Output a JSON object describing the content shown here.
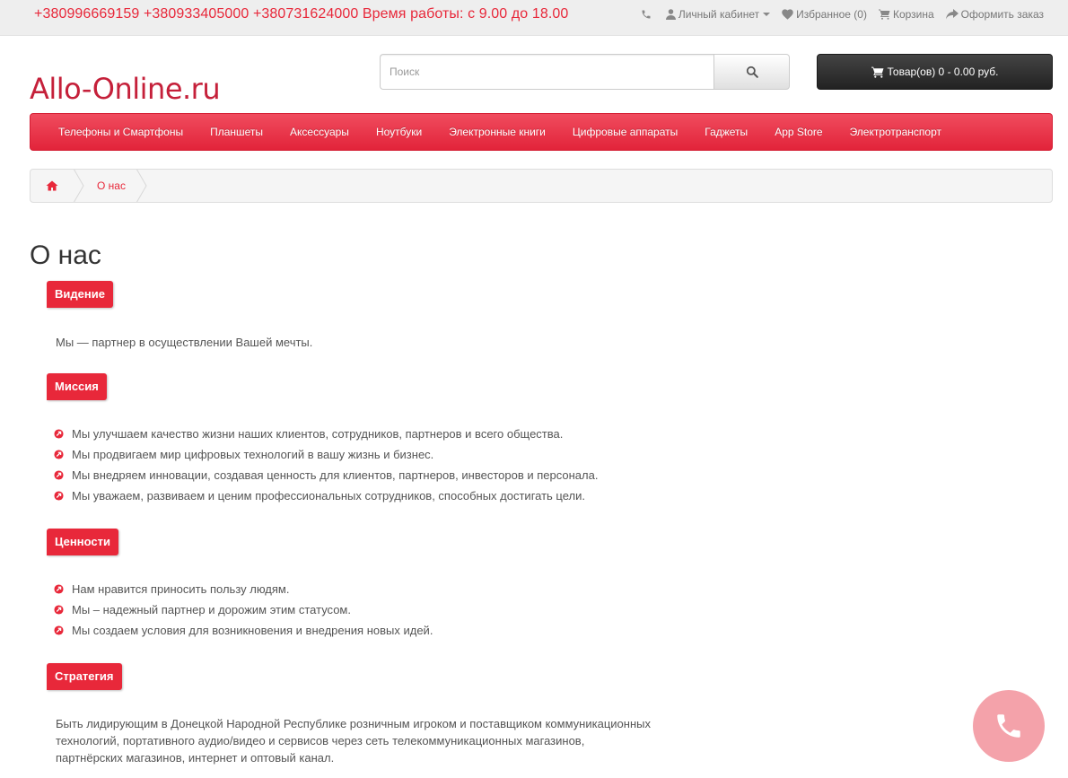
{
  "topbar": {
    "phones": "+380996669159 +380933405000 +380731624000 Время работы: с 9.00 до 18.00",
    "account_label": "Личный кабинет",
    "wishlist_label": "Избранное (0)",
    "cart_label": "Корзина",
    "checkout_label": "Оформить заказ"
  },
  "header": {
    "logo": "Allo-Online.ru",
    "search_placeholder": "Поиск",
    "search_value": "",
    "cart_button": "Товар(ов) 0 - 0.00 руб."
  },
  "menu": {
    "items": [
      "Телефоны и Смартфоны",
      "Планшеты",
      "Аксессуары",
      "Ноутбуки",
      "Электронные книги",
      "Цифровые аппараты",
      "Гаджеты",
      "App Store",
      "Электротранспорт"
    ]
  },
  "breadcrumb": {
    "current": "О нас"
  },
  "content": {
    "title": "О нас",
    "vision": {
      "label": "Видение",
      "text": "Мы — партнер в осуществлении Вашей мечты."
    },
    "mission": {
      "label": "Миссия",
      "items": [
        "Мы улучшаем качество жизни наших клиентов, сотрудников, партнеров и всего общества.",
        "Мы продвигаем мир цифровых технологий в вашу жизнь и бизнес.",
        "Мы внедряем инновации, создавая ценность для клиентов, партнеров, инвесторов и персонала.",
        "Мы уважаем, развиваем и ценим профессиональных сотрудников, способных достигать цели."
      ]
    },
    "values": {
      "label": "Ценности",
      "items": [
        "Нам нравится приносить пользу людям.",
        "Мы – надежный партнер и дорожим этим статусом.",
        "Мы создаем условия для возникновения и внедрения новых идей."
      ]
    },
    "strategy": {
      "label": "Стратегия",
      "lines": [
        "Быть лидирующим в Донецкой Народной Республике розничным игроком и поставщиком коммуникационных",
        "технологий, портативного аудио/видео и сервисов через сеть телекоммуникационных магазинов,",
        "партнёрских магазинов, интернет и оптовый канал."
      ]
    }
  },
  "colors": {
    "accent": "#e8283a",
    "logo": "#c5203a",
    "call_button": "#f4a2aa"
  },
  "icons": {
    "topbar": [
      "phone-icon",
      "user-icon",
      "heart-icon",
      "shopping-cart-icon",
      "share-icon"
    ],
    "search": "search-icon",
    "breadcrumb_home": "home-icon",
    "bullets": "circle-arrow-icon",
    "call": "phone-handset-icon"
  }
}
